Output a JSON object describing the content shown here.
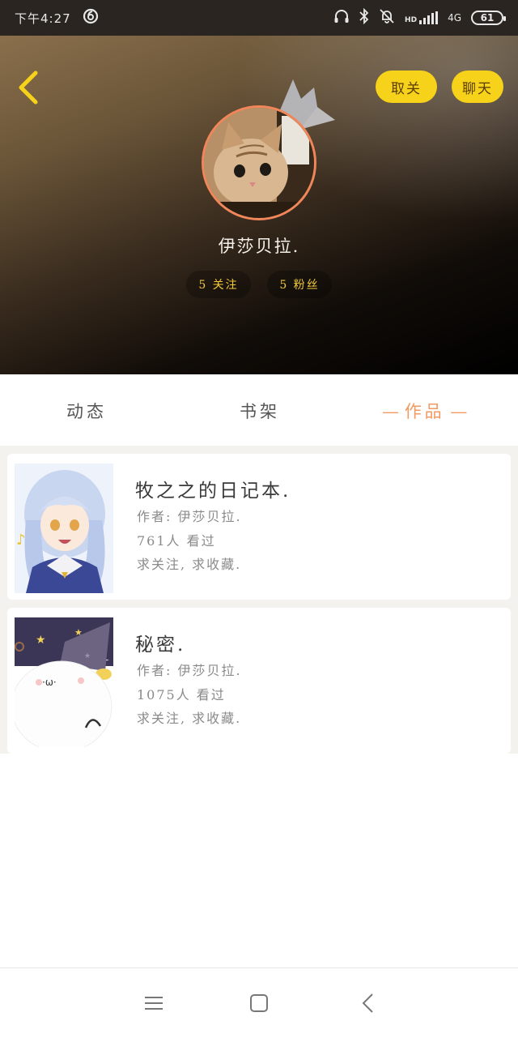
{
  "status_bar": {
    "time": "下午4:27",
    "network": "4G",
    "hd": "HD",
    "battery": "61"
  },
  "header": {
    "unfollow_label": "取关",
    "chat_label": "聊天",
    "username": "伊莎贝拉.",
    "following_text": "5 关注",
    "fans_text": "5 粉丝"
  },
  "tabs": {
    "dynamics": "动态",
    "shelf": "书架",
    "works": "作品",
    "active": "works",
    "active_color": "#f29a61"
  },
  "works": [
    {
      "title": "牧之之的日记本.",
      "author": "作者: 伊莎贝拉.",
      "views": "761人 看过",
      "note": "求关注, 求收藏."
    },
    {
      "title": "秘密.",
      "author": "作者: 伊莎贝拉.",
      "views": "1075人 看过",
      "note": "求关注, 求收藏."
    }
  ],
  "nav": {
    "menu_icon": "menu-icon",
    "home_icon": "home-icon",
    "back_icon": "back-icon"
  },
  "colors": {
    "accent_yellow": "#f6d21a",
    "avatar_ring": "#f0865a",
    "stat_text": "#f1c93a"
  }
}
